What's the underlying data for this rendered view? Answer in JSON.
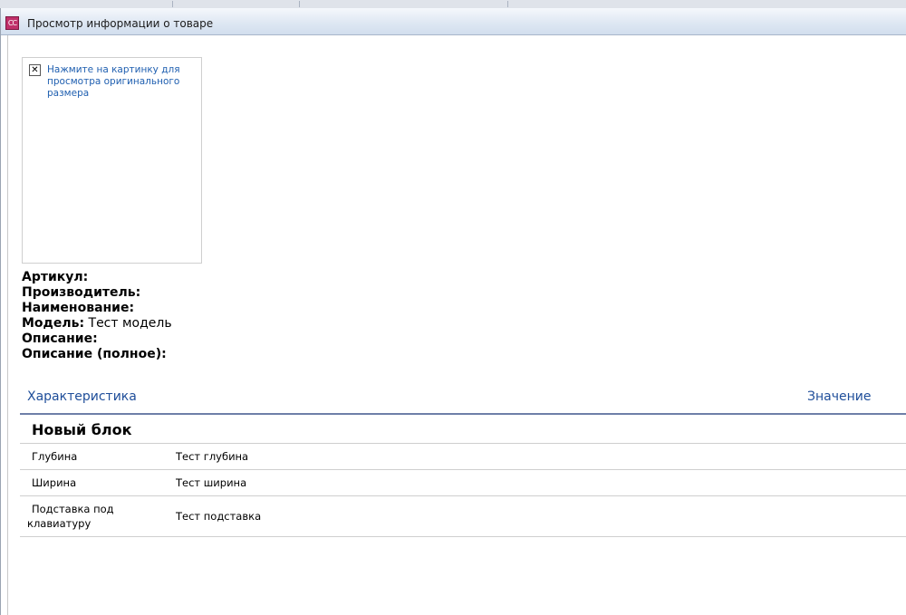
{
  "window": {
    "icon_text": "CC",
    "title": "Просмотр информации о товаре"
  },
  "image": {
    "alt_text": "Нажмите на картинку для просмотра оригинального размера"
  },
  "product": {
    "fields": [
      {
        "label": "Артикул:",
        "value": ""
      },
      {
        "label": "Производитель:",
        "value": ""
      },
      {
        "label": "Наименование:",
        "value": ""
      },
      {
        "label": "Модель:",
        "value": " Тест модель"
      },
      {
        "label": "Описание:",
        "value": ""
      },
      {
        "label": "Описание (полное):",
        "value": ""
      }
    ]
  },
  "specs": {
    "header": {
      "characteristic": "Характеристика",
      "value": "Значение"
    },
    "block_title": "Новый блок",
    "rows": [
      {
        "name": "Глубина",
        "value": "Тест глубина"
      },
      {
        "name": "Ширина",
        "value": "Тест ширина"
      },
      {
        "name": "Подставка под клавиатуру",
        "value": "Тест подставка"
      }
    ]
  }
}
